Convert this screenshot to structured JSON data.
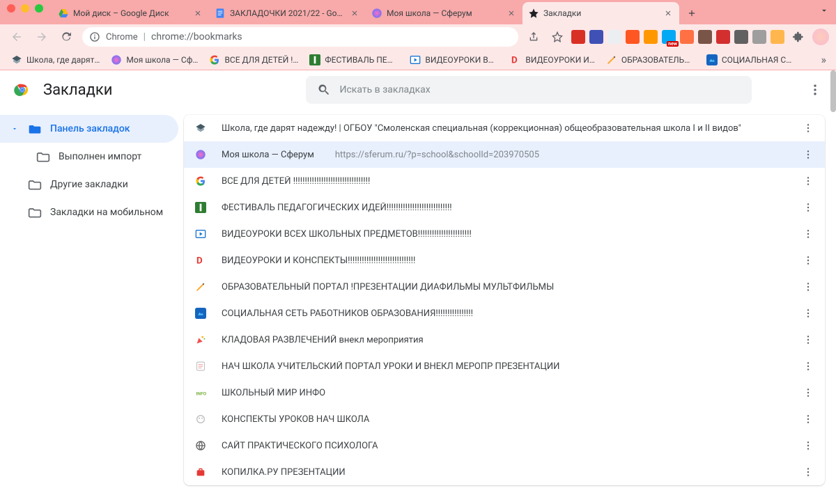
{
  "tabs": [
    {
      "title": "Мой диск – Google Диск",
      "favicon": "gdrive"
    },
    {
      "title": "ЗАКЛАДОЧКИ 2021/22 - Goo…",
      "favicon": "gdocs"
    },
    {
      "title": "Моя школа — Сферум",
      "favicon": "sferum"
    },
    {
      "title": "Закладки",
      "favicon": "star",
      "active": true
    }
  ],
  "omnibox": {
    "secure_label": "Chrome",
    "url": "chrome://bookmarks"
  },
  "bookmarks_bar": [
    {
      "label": "Школа, где дарят…",
      "icon": "school"
    },
    {
      "label": "Моя школа — Сф…",
      "icon": "sferum"
    },
    {
      "label": "ВСЕ ДЛЯ ДЕТЕЙ !…",
      "icon": "google"
    },
    {
      "label": "ФЕСТИВАЛЬ ПЕД…",
      "icon": "fest"
    },
    {
      "label": "ВИДЕОУРОКИ ВС…",
      "icon": "video"
    },
    {
      "label": "ВИДЕОУРОКИ И…",
      "icon": "redD"
    },
    {
      "label": "ОБРАЗОВАТЕЛЬН…",
      "icon": "pencil"
    },
    {
      "label": "СОЦИАЛЬНАЯ С…",
      "icon": "blue"
    }
  ],
  "app": {
    "title": "Закладки",
    "search_placeholder": "Искать в закладках"
  },
  "sidebar": [
    {
      "label": "Панель закладок",
      "selected": true,
      "expandable": true
    },
    {
      "label": "Выполнен импорт",
      "child": true
    },
    {
      "label": "Другие закладки"
    },
    {
      "label": "Закладки на мобильном"
    }
  ],
  "list": [
    {
      "icon": "school",
      "title": "Школа, где дарят надежду! | ОГБОУ \"Смоленская специальная (коррекционная) общеобразовательная школа I и II видов\""
    },
    {
      "icon": "sferum",
      "title": "Моя школа — Сферум",
      "url": "https://sferum.ru/?p=school&schoolId=203970505",
      "selected": true
    },
    {
      "icon": "google",
      "title": "ВСЕ ДЛЯ ДЕТЕЙ !!!!!!!!!!!!!!!!!!!!!!!!!!!!!!!!!"
    },
    {
      "icon": "fest",
      "title": "ФЕСТИВАЛЬ ПЕДАГОГИЧЕСКИХ ИДЕЙ!!!!!!!!!!!!!!!!!!!!!!!!!!!!"
    },
    {
      "icon": "video",
      "title": "ВИДЕОУРОКИ ВСЕХ ШКОЛЬНЫХ ПРЕДМЕТОВ!!!!!!!!!!!!!!!!!!!!!!!"
    },
    {
      "icon": "redD",
      "title": "ВИДЕОУРОКИ И КОНСПЕКТЫ!!!!!!!!!!!!!!!!!!!!!!!!!!!!!"
    },
    {
      "icon": "pencil",
      "title": "ОБРАЗОВАТЕЛЬНЫЙ ПОРТАЛ !ПРЕЗЕНТАЦИИ ДИАФИЛЬМЫ МУЛЬТФИЛЬМЫ"
    },
    {
      "icon": "blue",
      "title": "СОЦИАЛЬНАЯ СЕТЬ РАБОТНИКОВ ОБРАЗОВАНИЯ!!!!!!!!!!!!!!!!"
    },
    {
      "icon": "party",
      "title": "КЛАДОВАЯ РАЗВЛЕЧЕНИЙ внекл мероприятия"
    },
    {
      "icon": "note",
      "title": "НАЧ ШКОЛА УЧИТЕЛЬСКИЙ ПОРТАЛ УРОКИ И ВНЕКЛ МЕРОПР ПРЕЗЕНТАЦИИ"
    },
    {
      "icon": "info",
      "title": "ШКОЛЬНЫЙ МИР ИНФО"
    },
    {
      "icon": "brain",
      "title": "КОНСПЕКТЫ УРОКОВ НАЧ ШКОЛА"
    },
    {
      "icon": "globe",
      "title": "САЙТ ПРАКТИЧЕСКОГО ПСИХОЛОГА"
    },
    {
      "icon": "bag",
      "title": "КОПИЛКА.РУ ПРЕЗЕНТАЦИИ"
    }
  ],
  "ext_icons": [
    "#d93025",
    "#3f51b5",
    "#eceff1",
    "#ff5722",
    "#ff9800",
    "#03a9f4",
    "#ff7043",
    "#795548",
    "#d32f2f",
    "#616161",
    "#9e9e9e",
    "#ffb74d"
  ]
}
